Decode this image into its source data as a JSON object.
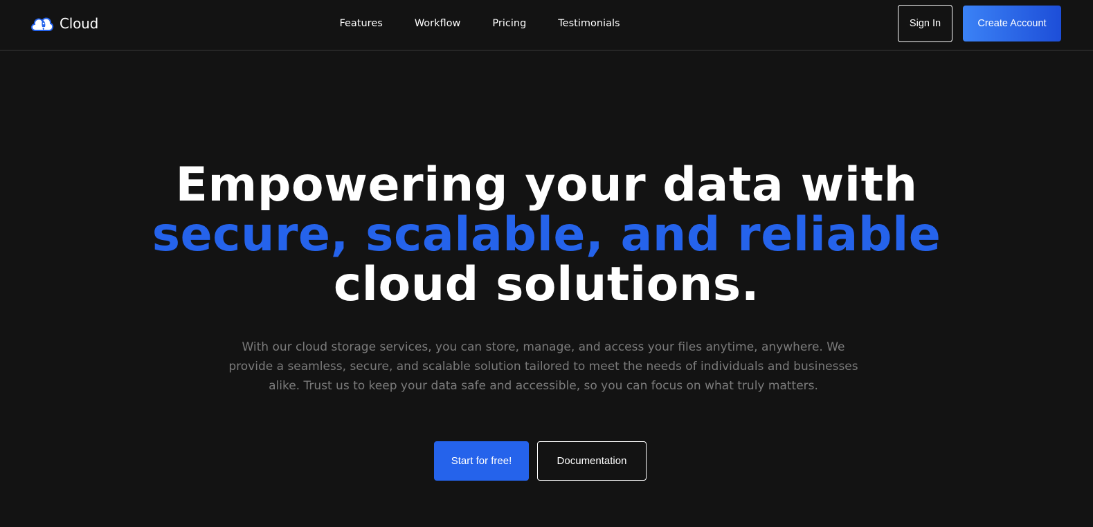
{
  "brand": {
    "name": "Cloud",
    "icon": "cloud-rocket-icon",
    "color": "#2563eb"
  },
  "nav": {
    "links": [
      "Features",
      "Workflow",
      "Pricing",
      "Testimonials"
    ]
  },
  "header_actions": {
    "sign_in": "Sign In",
    "create_account": "Create Account"
  },
  "hero": {
    "title_line1": "Empowering your data with",
    "title_line2": "secure, scalable, and reliable",
    "title_line3": "cloud solutions.",
    "description": "With our cloud storage services, you can store, manage, and access your files anytime, anywhere. We provide a seamless, secure, and scalable solution tailored to meet the needs of individuals and businesses alike. Trust us to keep your data safe and accessible, so you can focus on what truly matters.",
    "primary_cta": "Start for free!",
    "secondary_cta": "Documentation"
  },
  "colors": {
    "background": "#131313",
    "accent": "#2563eb",
    "text": "#ffffff",
    "muted": "#7b7b7b"
  }
}
